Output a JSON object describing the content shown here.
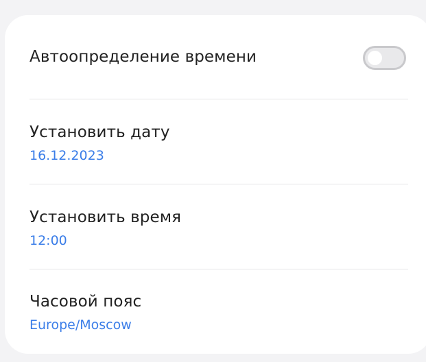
{
  "settings": {
    "auto_time": {
      "label": "Автоопределение времени",
      "enabled": false
    },
    "date": {
      "label": "Установить дату",
      "value": "16.12.2023"
    },
    "time": {
      "label": "Установить время",
      "value": "12:00"
    },
    "timezone": {
      "label": "Часовой пояс",
      "value": "Europe/Moscow"
    }
  },
  "colors": {
    "accent": "#3a7de8",
    "toggle_off": "#c9c9cc",
    "background": "#f3f3f5"
  }
}
